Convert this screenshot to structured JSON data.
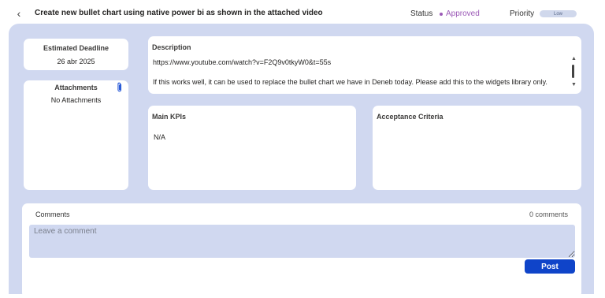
{
  "header": {
    "back_icon": "chevron-left-icon",
    "title": "Create new bullet chart using native power bi as shown in the attached video",
    "status_label": "Status",
    "status_value": "Approved",
    "status_color": "#9b59b6",
    "priority_label": "Priority",
    "priority_value": "Low"
  },
  "deadline": {
    "label": "Estimated Deadline",
    "value": "26 abr 2025"
  },
  "attachments": {
    "label": "Attachments",
    "empty_text": "No Attachments",
    "icon": "paperclip-icon"
  },
  "description": {
    "label": "Description",
    "url": "https://www.youtube.com/watch?v=F2Q9v0tkyW0&t=55s",
    "text": "If this works well, it can be used to replace the bullet chart we have in Deneb today. Please add this to the widgets library only."
  },
  "kpis": {
    "label": "Main KPIs",
    "value": "N/A"
  },
  "acceptance": {
    "label": "Acceptance Criteria"
  },
  "comments": {
    "label": "Comments",
    "count": "0 comments",
    "placeholder": "Leave a comment",
    "post_label": "Post"
  },
  "colors": {
    "panel": "#d0d8f0",
    "accent": "#0f44c9"
  }
}
